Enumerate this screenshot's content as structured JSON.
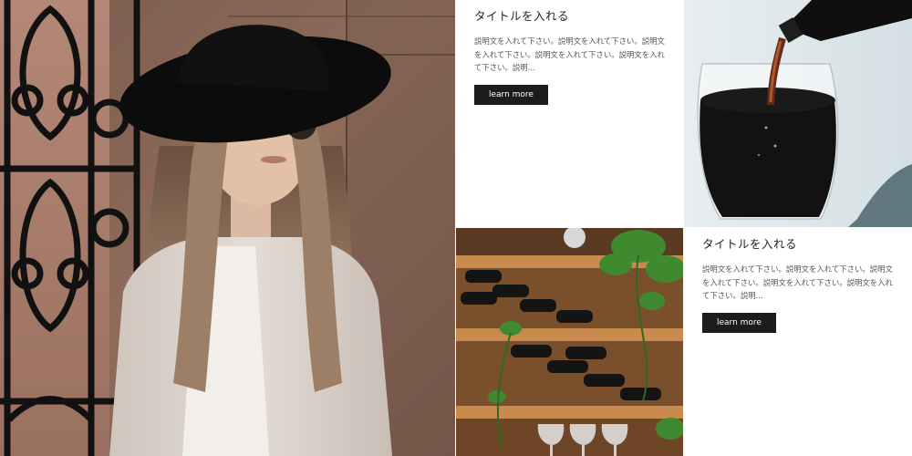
{
  "cards": [
    {
      "title": "タイトルを入れる",
      "body": "説明文を入れて下さい。説明文を入れて下さい。説明文を入れて下さい。説明文を入れて下さい。説明文を入れて下さい。説明...",
      "button_label": "learn more"
    },
    {
      "title": "タイトルを入れる",
      "body": "説明文を入れて下さい。説明文を入れて下さい。説明文を入れて下さい。説明文を入れて下さい。説明文を入れて下さい。説明...",
      "button_label": "learn more"
    }
  ],
  "images": {
    "hero": "woman-in-black-hat-and-sunglasses",
    "wine": "red-wine-pouring-into-glass",
    "shelf": "wine-bottles-on-wooden-shelves-with-plants"
  },
  "colors": {
    "button_bg": "#1c1c1c",
    "button_text": "#ffffff",
    "background": "#ffffff"
  }
}
